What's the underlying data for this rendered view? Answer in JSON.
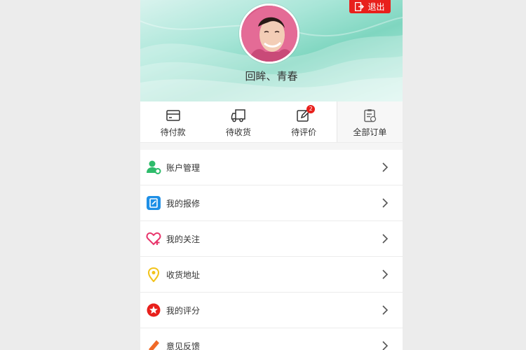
{
  "header": {
    "logout_label": "退出",
    "username": "回眸、青春"
  },
  "orders": [
    {
      "label": "待付款",
      "icon": "card-icon"
    },
    {
      "label": "待收货",
      "icon": "truck-icon"
    },
    {
      "label": "待评价",
      "icon": "edit-icon",
      "badge": "2"
    },
    {
      "label": "全部订单",
      "icon": "clipboard-icon"
    }
  ],
  "menu": [
    {
      "label": "账户管理",
      "icon": "user-settings-icon",
      "color": "#2dbb6a"
    },
    {
      "label": "我的报修",
      "icon": "repair-doc-icon",
      "color": "#1e8fe6"
    },
    {
      "label": "我的关注",
      "icon": "heart-plus-icon",
      "color": "#e8356b"
    },
    {
      "label": "收货地址",
      "icon": "location-pin-icon",
      "color": "#f2c31a"
    },
    {
      "label": "我的评分",
      "icon": "star-icon",
      "color": "#e8201c"
    },
    {
      "label": "意见反馈",
      "icon": "pencil-icon",
      "color": "#f06a28"
    }
  ],
  "colors": {
    "accent": "#e8201c"
  }
}
